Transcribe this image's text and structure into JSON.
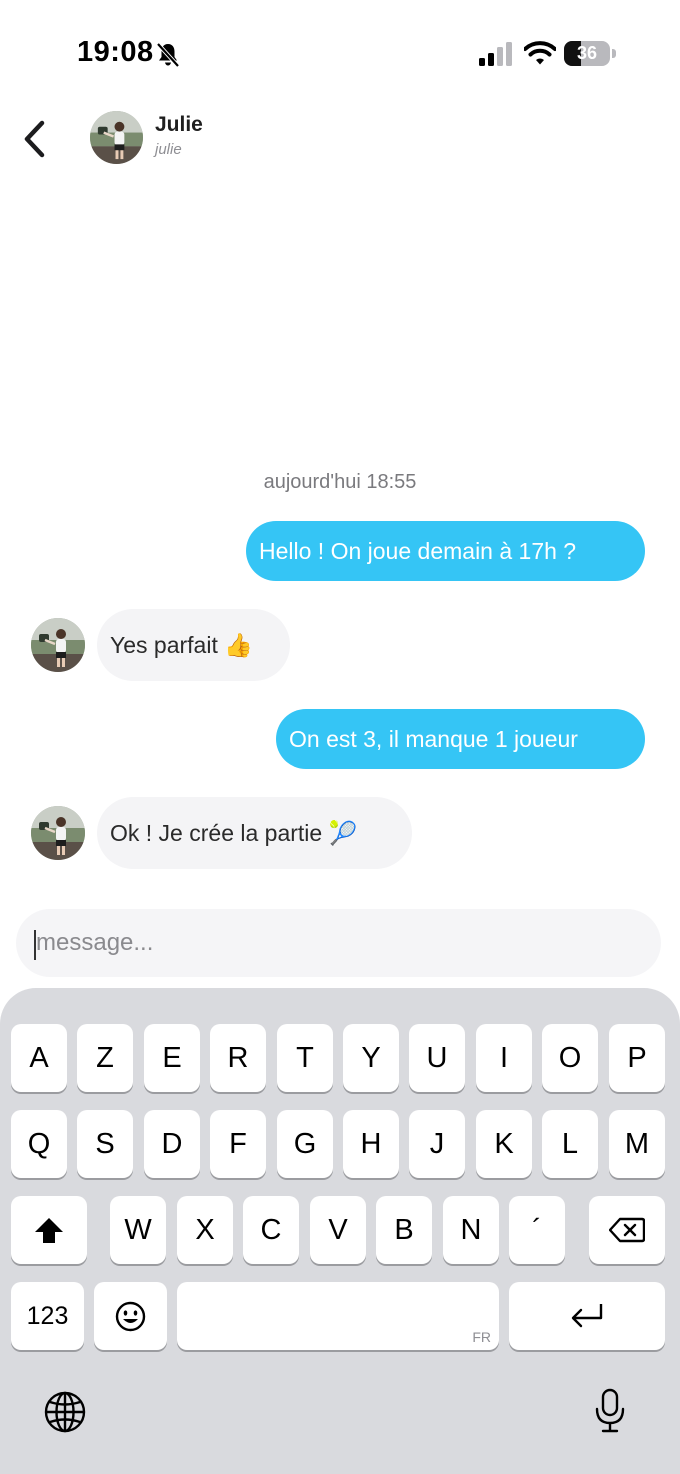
{
  "status_bar": {
    "time": "19:08",
    "battery_level": "36",
    "battery_fraction": 0.36,
    "icons": [
      "bell-slash-icon",
      "cellular-signal-icon",
      "wifi-icon",
      "battery-icon"
    ]
  },
  "header": {
    "contact_name": "Julie",
    "contact_handle": "julie",
    "back_icon": "chevron-left-icon"
  },
  "chat": {
    "date_separator": "aujourd'hui 18:55",
    "messages": [
      {
        "direction": "sent",
        "text": "Hello ! On joue demain à 17h ?"
      },
      {
        "direction": "received",
        "text": "Yes parfait 👍"
      },
      {
        "direction": "sent",
        "text": "On est 3, il manque 1 joueur"
      },
      {
        "direction": "received",
        "text": "Ok ! Je crée la partie 🎾"
      }
    ]
  },
  "composer": {
    "placeholder": "message..."
  },
  "keyboard": {
    "row1": [
      "A",
      "Z",
      "E",
      "R",
      "T",
      "Y",
      "U",
      "I",
      "O",
      "P"
    ],
    "row2": [
      "Q",
      "S",
      "D",
      "F",
      "G",
      "H",
      "J",
      "K",
      "L",
      "M"
    ],
    "row3": [
      "W",
      "X",
      "C",
      "V",
      "B",
      "N",
      "´"
    ],
    "numbers_label": "123",
    "space_language": "FR",
    "icons": [
      "shift-icon",
      "backspace-icon",
      "emoji-icon",
      "return-icon",
      "globe-icon",
      "microphone-icon"
    ]
  },
  "colors": {
    "sent_bubble": "#35c5f5",
    "received_bubble": "#f4f4f6",
    "keyboard_bg": "#d9dade"
  }
}
